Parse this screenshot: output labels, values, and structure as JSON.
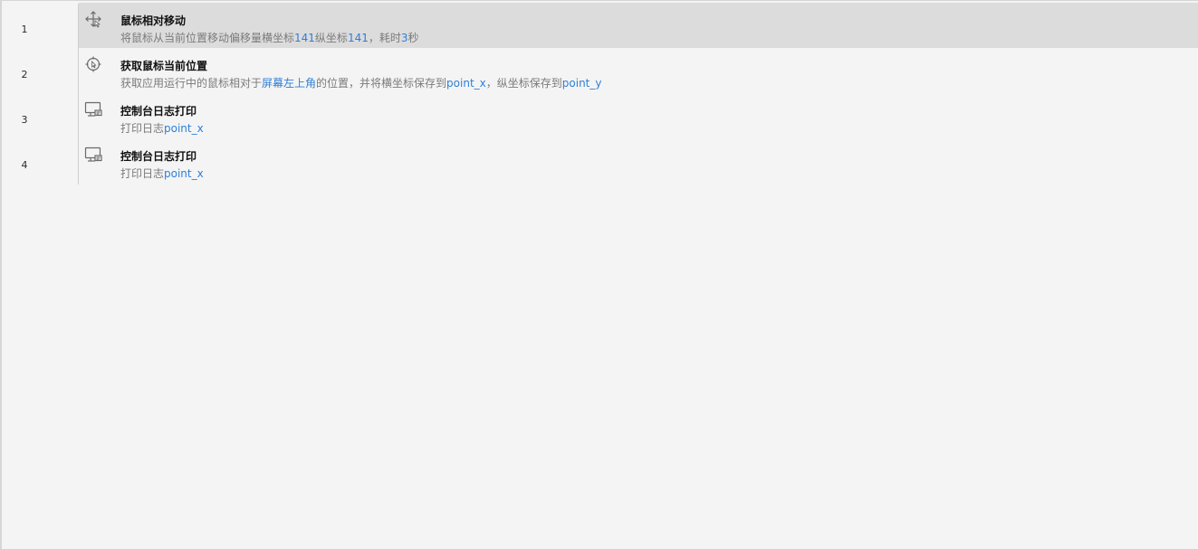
{
  "steps": [
    {
      "line": "1",
      "title": "鼠标相对移动",
      "icon": "move-arrows-icon",
      "desc": {
        "t1": "将鼠标从当前位置移动偏移量横坐标",
        "v1": "141",
        "t2": "纵坐标",
        "v2": "141",
        "t3": "，耗时",
        "v3": "3",
        "t4": "秒"
      }
    },
    {
      "line": "2",
      "title": "获取鼠标当前位置",
      "icon": "crosshair-target-icon",
      "desc": {
        "t1": "获取应用运行中的鼠标相对于",
        "v1": "屏幕左上角",
        "t2": "的位置，并将横坐标保存到",
        "v2": "point_x",
        "t3": "，纵坐标保存到",
        "v3": "point_y"
      }
    },
    {
      "line": "3",
      "title": "控制台日志打印",
      "icon": "console-print-icon",
      "desc": {
        "t1": "打印日志",
        "v1": "point_x"
      }
    },
    {
      "line": "4",
      "title": "控制台日志打印",
      "icon": "console-print-icon",
      "desc": {
        "t1": "打印日志",
        "v1": "point_x"
      }
    }
  ],
  "colors": {
    "variable": "#2f7fd6",
    "selected_row": "#dcdcdc",
    "background": "#f4f4f4"
  }
}
